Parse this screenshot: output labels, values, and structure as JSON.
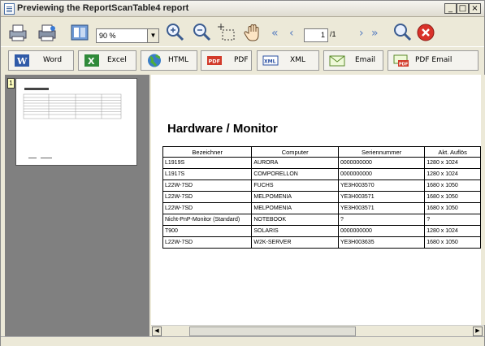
{
  "window": {
    "title": "Previewing the ReportScanTable4 report"
  },
  "toolbar": {
    "zoom_value": "90 %",
    "current_page": "1",
    "page_total": "/1"
  },
  "export": [
    {
      "label": "Word"
    },
    {
      "label": "Excel"
    },
    {
      "label": "HTML"
    },
    {
      "label": "PDF"
    },
    {
      "label": "XML"
    },
    {
      "label": "Email"
    },
    {
      "label": "PDF Email"
    }
  ],
  "icon_text": {
    "pdf": "PDF",
    "xml": "XML"
  },
  "report": {
    "title": "Hardware / Monitor",
    "columns": [
      "Bezeichner",
      "Computer",
      "Seriennummer",
      "Akt. Auflös"
    ],
    "rows": [
      [
        "L1919S",
        "AURORA",
        "0000000000",
        "1280 x 1024"
      ],
      [
        "L1917S",
        "COMPORELLON",
        "0000000000",
        "1280 x 1024"
      ],
      [
        "L22W-7SD",
        "FUCHS",
        "YE3H003570",
        "1680 x 1050"
      ],
      [
        "L22W-7SD",
        "MELPOMENIA",
        "YE3H003571",
        "1680 x 1050"
      ],
      [
        "L22W-7SD",
        "MELPOMENIA",
        "YE3H003571",
        "1680 x 1050"
      ],
      [
        "Nicht-PnP-Monitor (Standard)",
        "NOTEBOOK",
        "?",
        "?"
      ],
      [
        "T900",
        "SOLARIS",
        "0000000000",
        "1280 x 1024"
      ],
      [
        "L22W-7SD",
        "W2K-SERVER",
        "YE3H003635",
        "1680 x 1050"
      ]
    ]
  },
  "thumbnail": {
    "page_number": "1"
  }
}
